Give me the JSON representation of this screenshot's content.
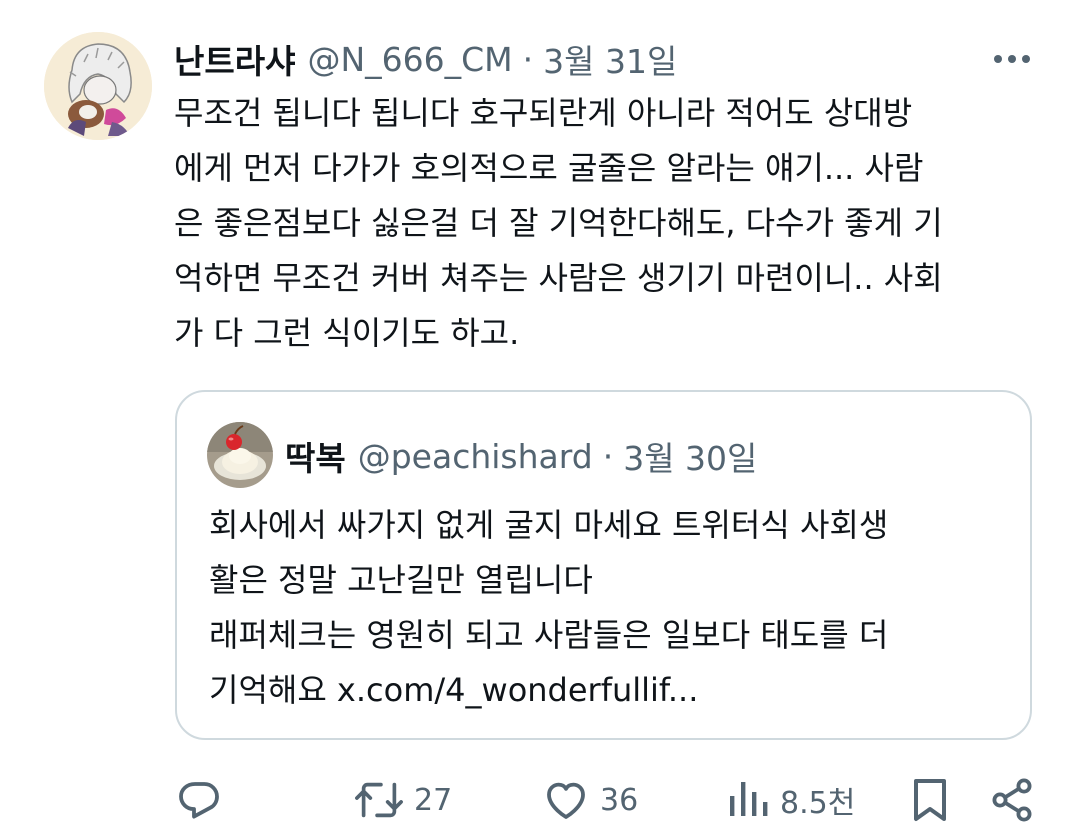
{
  "tweet": {
    "display_name": "난트라샤",
    "handle": "@N_666_CM",
    "separator": "·",
    "date": "3월 31일",
    "text": "무조건 됩니다 됩니다 호구되란게 아니라 적어도 상대방\n에게 먼저 다가가 호의적으로 굴줄은 알라는 얘기... 사람\n은 좋은점보다 싫은걸 더 잘 기억한다해도, 다수가 좋게 기\n억하면 무조건 커버 쳐주는 사람은 생기기 마련이니.. 사회\n가 다 그런 식이기도 하고."
  },
  "quote": {
    "display_name": "딱복",
    "handle": "@peachishard",
    "separator": "·",
    "date": "3월 30일",
    "text": "회사에서 싸가지 없게 굴지 마세요 트위터식 사회생\n활은 정말 고난길만 열립니다\n래퍼체크는 영원히 되고 사람들은 일보다 태도를 더\n기억해요 x.com/4_wonderfullif..."
  },
  "actions": {
    "reply_icon": "reply-icon",
    "retweet_icon": "retweet-icon",
    "retweet_count": "27",
    "like_icon": "heart-icon",
    "like_count": "36",
    "views_icon": "views-icon",
    "views_count": "8.5천",
    "bookmark_icon": "bookmark-icon",
    "share_icon": "share-icon"
  },
  "colors": {
    "text": "#0f1419",
    "secondary": "#536471",
    "border": "#cfd9de"
  }
}
